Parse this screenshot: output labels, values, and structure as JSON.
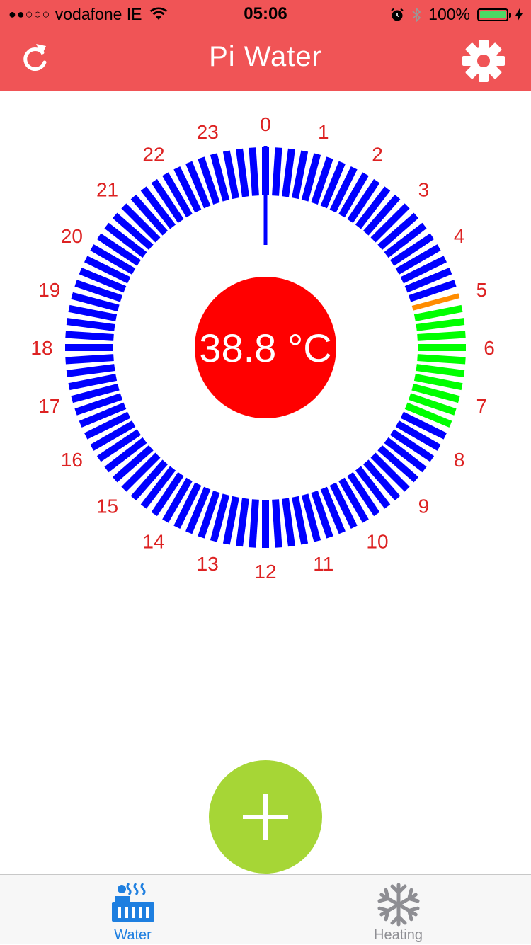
{
  "status_bar": {
    "signal_dots": "●●○○○",
    "carrier": "vodafone IE",
    "time": "05:06",
    "battery": "100%"
  },
  "header": {
    "title": "Pi Water",
    "left_icon": "refresh-icon",
    "right_icon": "gear-icon"
  },
  "dial": {
    "hour_labels": [
      "0",
      "1",
      "2",
      "3",
      "4",
      "5",
      "6",
      "7",
      "8",
      "9",
      "10",
      "11",
      "12",
      "13",
      "14",
      "15",
      "16",
      "17",
      "18",
      "19",
      "20",
      "21",
      "22",
      "23"
    ],
    "temperature_text": "38.8 °C",
    "current_time_hours": 5.1,
    "scheduled_on_hours": [
      5.25,
      7.5
    ],
    "segments_per_hour": 4,
    "colors": {
      "off": "#0000ff",
      "on": "#00ff00",
      "current": "#ff8c00",
      "labels": "#dd2222",
      "temperature_fill": "#ff0000",
      "hand": "#0000ff"
    }
  },
  "add_button": {
    "icon": "plus-icon"
  },
  "tabs": [
    {
      "label": "Water",
      "icon": "water-heater-icon",
      "active": true
    },
    {
      "label": "Heating",
      "icon": "snowflake-icon",
      "active": false
    }
  ],
  "colors": {
    "header_bg": "#f05456",
    "add_button": "#a6d636",
    "tab_active": "#1e7fe0",
    "tab_inactive": "#8e8e93"
  }
}
